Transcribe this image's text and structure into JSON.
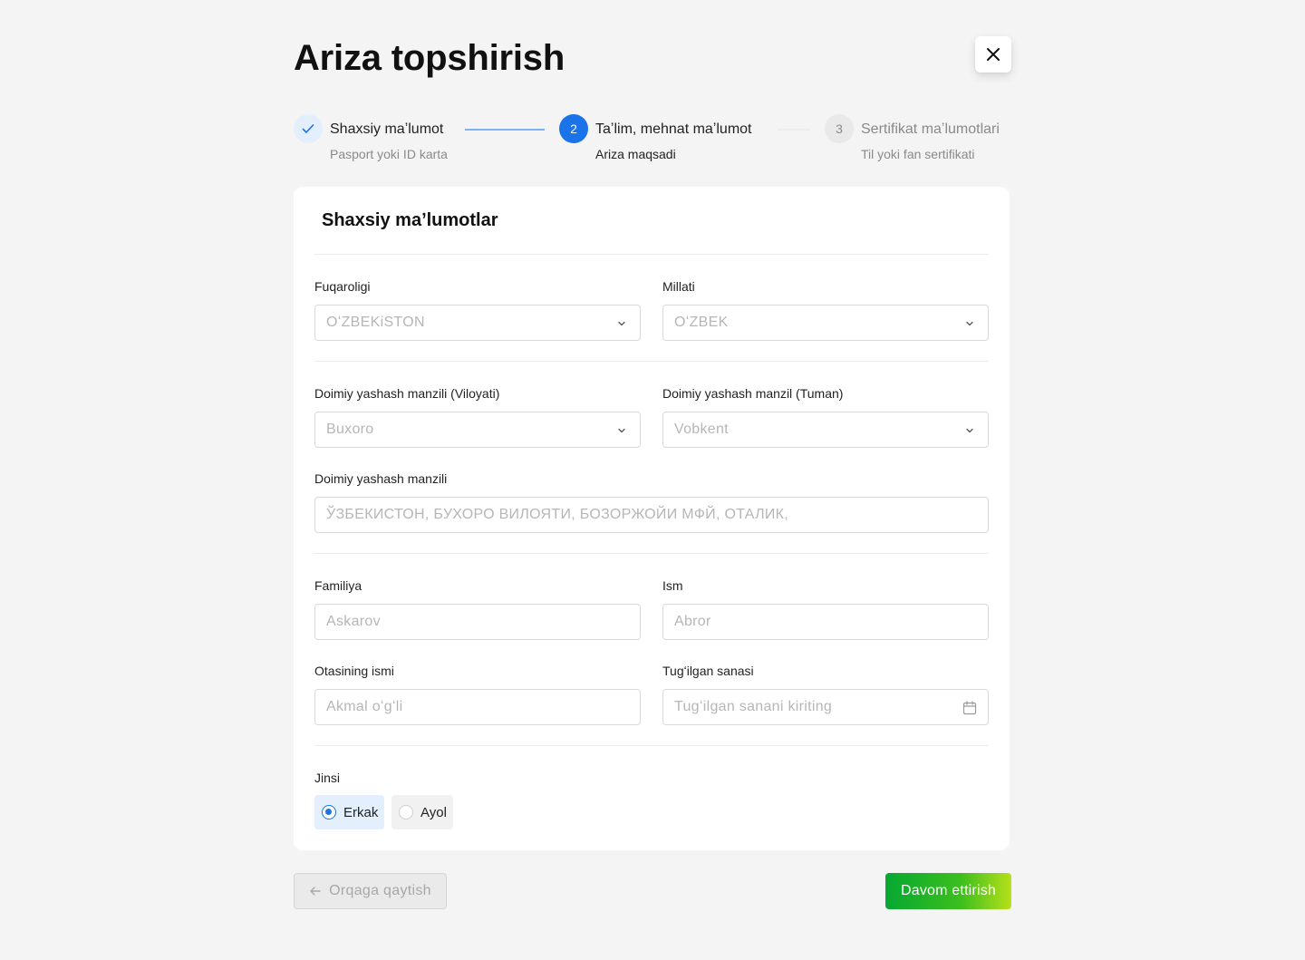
{
  "header": {
    "title": "Ariza topshirish",
    "close_icon": "close-icon"
  },
  "stepper": {
    "steps": [
      {
        "number": "",
        "title": "Shaxsiy maʼlumot",
        "subtitle": "Pasport yoki ID karta",
        "status": "completed"
      },
      {
        "number": "2",
        "title": "Taʼlim, mehnat maʼlumot",
        "subtitle": "Ariza maqsadi",
        "status": "active"
      },
      {
        "number": "3",
        "title": "Sertifikat maʼlumotlari",
        "subtitle": "Til yoki fan sertifikati",
        "status": "pending"
      }
    ]
  },
  "form": {
    "title": "Shaxsiy maʼlumotlar",
    "citizenship": {
      "label": "Fuqaroligi",
      "value": "OʻZBEKiSTON"
    },
    "nationality": {
      "label": "Millati",
      "value": "OʻZBEK"
    },
    "region": {
      "label": "Doimiy yashash manzili (Viloyati)",
      "value": "Buxoro"
    },
    "district": {
      "label": "Doimiy yashash manzil (Tuman)",
      "value": "Vobkent"
    },
    "address": {
      "label": "Doimiy yashash manzili",
      "value": "ЎЗБЕКИСТОН, БУХОРО ВИЛОЯТИ, БОЗОРЖОЙИ МФЙ, ОТАЛИК,"
    },
    "surname": {
      "label": "Familiya",
      "value": "Askarov"
    },
    "name": {
      "label": "Ism",
      "value": "Abror"
    },
    "patronymic": {
      "label": "Otasining ismi",
      "value": "Akmal oʻgʻli"
    },
    "birthdate": {
      "label": "Tugʻilgan sanasi",
      "placeholder": "Tugʻilgan sanani kiriting"
    },
    "gender": {
      "label": "Jinsi",
      "options": [
        {
          "label": "Erkak",
          "selected": true
        },
        {
          "label": "Ayol",
          "selected": false
        }
      ]
    }
  },
  "footer": {
    "back_label": "Orqaga qaytish",
    "next_label": "Davom ettirish"
  },
  "colors": {
    "accent": "#1a73e8",
    "completed_bg": "#e3effd",
    "next_gradient_start": "#06a832",
    "next_gradient_end": "#b7e01a"
  }
}
